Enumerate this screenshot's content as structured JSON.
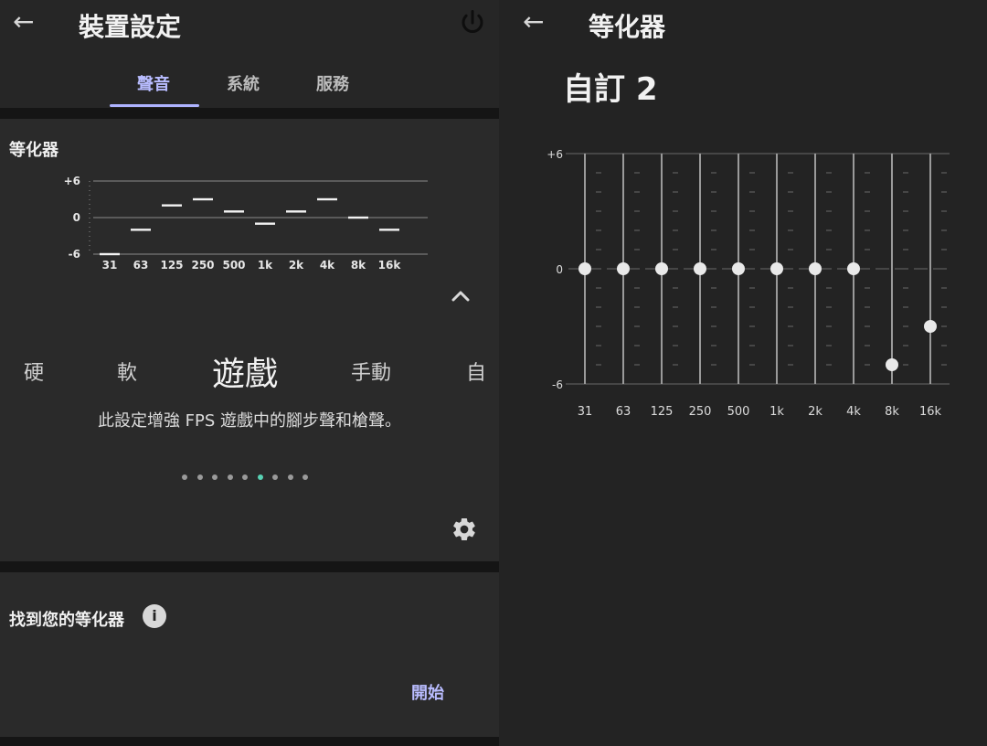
{
  "left": {
    "header": {
      "title": "裝置設定"
    },
    "tabs": [
      {
        "label": "聲音",
        "active": true
      },
      {
        "label": "系統",
        "active": false
      },
      {
        "label": "服務",
        "active": false
      }
    ],
    "equalizer_section": {
      "title": "等化器",
      "preset_carousel": {
        "items": [
          "硬",
          "軟",
          "遊戲",
          "手動",
          "自"
        ],
        "selected_index": 2
      },
      "description": "此設定增強 FPS 遊戲中的腳步聲和槍聲。",
      "dots": {
        "count": 9,
        "active_index": 5
      }
    },
    "find_equalizer_section": {
      "title": "找到您的等化器",
      "start_label": "開始"
    }
  },
  "right": {
    "header": {
      "title": "等化器"
    },
    "preset_title": "自訂 2"
  },
  "colors": {
    "accent": "#b8bcff",
    "dot_active": "#58d2b4",
    "background": "#232323"
  },
  "chart_data": [
    {
      "type": "bar",
      "title": "",
      "categories": [
        "31",
        "63",
        "125",
        "250",
        "500",
        "1k",
        "2k",
        "4k",
        "8k",
        "16k"
      ],
      "y_tick_labels": [
        "+6",
        "0",
        "-6"
      ],
      "ylim": [
        -6,
        6
      ],
      "values": [
        -6,
        -2,
        2,
        3,
        1,
        -1,
        1,
        3,
        0,
        -2
      ]
    },
    {
      "type": "scatter",
      "title": "",
      "categories": [
        "31",
        "63",
        "125",
        "250",
        "500",
        "1k",
        "2k",
        "4k",
        "8k",
        "16k"
      ],
      "y_tick_labels": [
        "+6",
        "0",
        "-6"
      ],
      "ylim": [
        -6,
        6
      ],
      "values": [
        0,
        0,
        0,
        0,
        0,
        0,
        0,
        0,
        -5,
        -3
      ]
    }
  ],
  "icons": {
    "back": "arrow-left",
    "power": "power",
    "chevron": "chevron-up",
    "settings": "gear",
    "info": "info"
  }
}
